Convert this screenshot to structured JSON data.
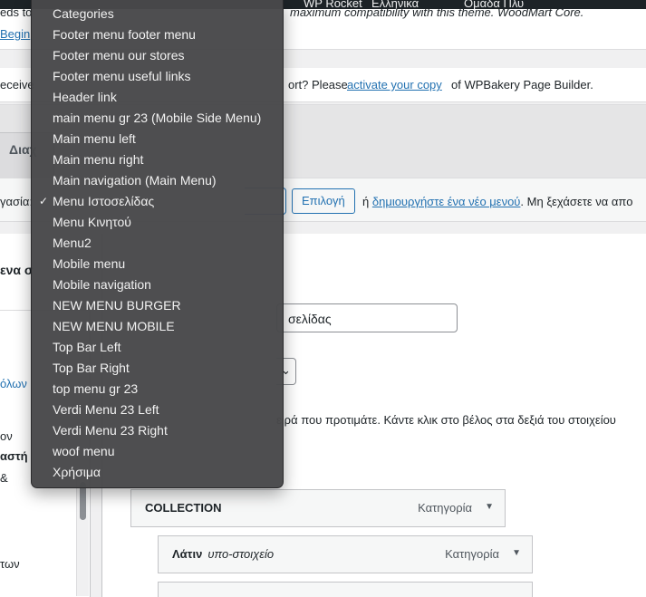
{
  "adminbar": {
    "item1": "WP Rocket",
    "item2": "Ελληνικά",
    "item3": "Ομάδα Πλυ"
  },
  "notice1": {
    "line1_tail": "maximum compatibility with this theme. WoodMart Core.",
    "line1_head": "eds to",
    "link": "Begin"
  },
  "notice2": {
    "head": "eceive",
    "text": "ort? Please",
    "link": "activate your copy",
    "tail": "of WPBakery Page Builder."
  },
  "tab": {
    "label": "Διαχ"
  },
  "select_bar": {
    "label": "γασία:",
    "select_button": "Επιλογή",
    "or": "ή",
    "create_link": "δημιουργήστε ένα νέο μενού",
    "tail": ". Μη ξεχάσετε να απο"
  },
  "left": {
    "heading": "ενα σ",
    "items": [
      "όλων",
      "ον",
      "αστή",
      "&",
      "των"
    ]
  },
  "editor": {
    "name_value": "σελίδας",
    "help_text": "ειρά που προτιμάτε. Κάντε κλικ στο βέλος στα δεξιά του στοιχείου",
    "items": [
      {
        "title": "COLLECTION",
        "subtitle": "",
        "kind": "Κατηγορία"
      },
      {
        "title": "Λάτιν",
        "subtitle": "υπο-στοιχείο",
        "kind": "Κατηγορία"
      }
    ],
    "arrow": "▼"
  },
  "dropdown": {
    "selected": "Menu Ιστοσελίδας",
    "options": [
      "Categories",
      "Footer menu footer menu",
      "Footer menu our stores",
      "Footer menu useful links",
      "Header link",
      "main menu gr 23 (Mobile Side Menu)",
      "Main menu left",
      "Main menu right",
      "Main navigation (Main Menu)",
      "Menu Ιστοσελίδας",
      "Menu Κινητού",
      "Menu2",
      "Mobile menu",
      "Mobile navigation",
      "NEW MENU BURGER",
      "NEW MENU MOBILE",
      "Top Bar Left",
      "Top Bar Right",
      "top menu gr 23",
      "Verdi Menu 23 Left",
      "Verdi Menu 23 Right",
      "woof menu",
      "Χρήσιμα"
    ]
  },
  "colors": {
    "link": "#2271b1",
    "dropdown_bg": "#48484a"
  }
}
